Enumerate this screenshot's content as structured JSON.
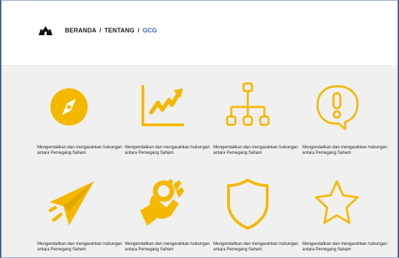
{
  "breadcrumb": {
    "home": "BERANDA",
    "separator_1": "/",
    "about": "TENTANG",
    "separator_2": "/",
    "current": "GCG"
  },
  "colors": {
    "accent_yellow": "#f5b800",
    "breadcrumb_active": "#2b63c9",
    "content_bg": "#f0f0f0"
  },
  "items": [
    {
      "icon": "compass-icon",
      "caption": "Mengendalikan dan mengarahkan hubungan antara Pemegang Saham"
    },
    {
      "icon": "trend-chart-icon",
      "caption": "Mengendalikan dan mengarahkan hubungan antara Pemegang Saham"
    },
    {
      "icon": "org-chart-icon",
      "caption": "Mengendalikan dan mengarahkan hubungan antara Pemegang Saham"
    },
    {
      "icon": "alert-bubble-icon",
      "caption": "Mengendalikan dan mengarahkan hubungan antara Pemegang Saham"
    },
    {
      "icon": "paper-plane-icon",
      "caption": "Mengendalikan dan mengarahkan hubungan antara Pemegang Saham"
    },
    {
      "icon": "ok-hand-icon",
      "caption": "Mengendalikan dan mengarahkan hubungan antara Pemegang Saham"
    },
    {
      "icon": "shield-icon",
      "caption": "Mengendalikan dan mengarahkan hubungan antara Pemegang Saham"
    },
    {
      "icon": "star-icon",
      "caption": "Mengendalikan dan mengarahkan hubungan antara Pemegang Saham"
    }
  ]
}
